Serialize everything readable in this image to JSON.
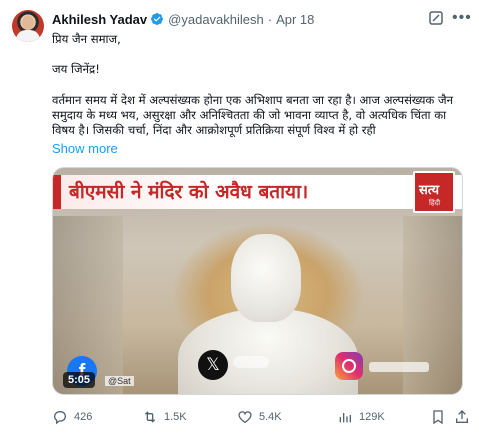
{
  "author": {
    "name": "Akhilesh Yadav",
    "handle": "@yadavakhilesh",
    "separator": "·",
    "date": "Apr 18"
  },
  "body": {
    "line1": "प्रिय जैन समाज,",
    "line2": "जय जिनेंद्र!",
    "line3": "वर्तमान समय में देश में अल्पसंख्यक होना एक अभिशाप बनता जा रहा है। आज अल्पसंख्यक जैन समुदाय के मध्य भय, असुरक्षा और अनिश्चितता की जो भावना व्याप्त है, वो अत्यधिक चिंता का विषय है। जिसकी चर्चा, निंदा और आक्रोशपूर्ण प्रतिक्रिया संपूर्ण विश्व में हो रही",
    "show_more": "Show more"
  },
  "media": {
    "banner_text": "बीएमसी ने मंदिर को अवैध बताया।",
    "channel_logo": "सत्य",
    "channel_sub": "हिंदी",
    "duration": "5:05",
    "source_handle": "@Sat"
  },
  "actions": {
    "replies": "426",
    "reposts": "1.5K",
    "likes": "5.4K",
    "views": "129K"
  },
  "colors": {
    "accent": "#1d9bf0",
    "muted": "#536471",
    "banner_red": "#c62828"
  }
}
